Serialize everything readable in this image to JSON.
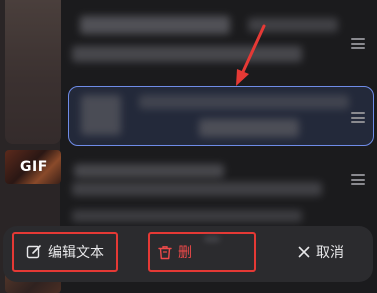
{
  "thumbnails": {
    "gif_badge": "GIF"
  },
  "action_bar": {
    "edit_label": "编辑文本",
    "delete_label": "删",
    "cancel_label": "取消"
  },
  "colors": {
    "background": "#1b1b1d",
    "selected_border": "#6f8ce8",
    "annotation_red": "#e53935",
    "delete_text": "#f04a4a"
  },
  "icons": {
    "edit": "edit-icon",
    "delete": "trash-icon",
    "cancel": "close-icon",
    "drag": "drag-handle-icon"
  }
}
